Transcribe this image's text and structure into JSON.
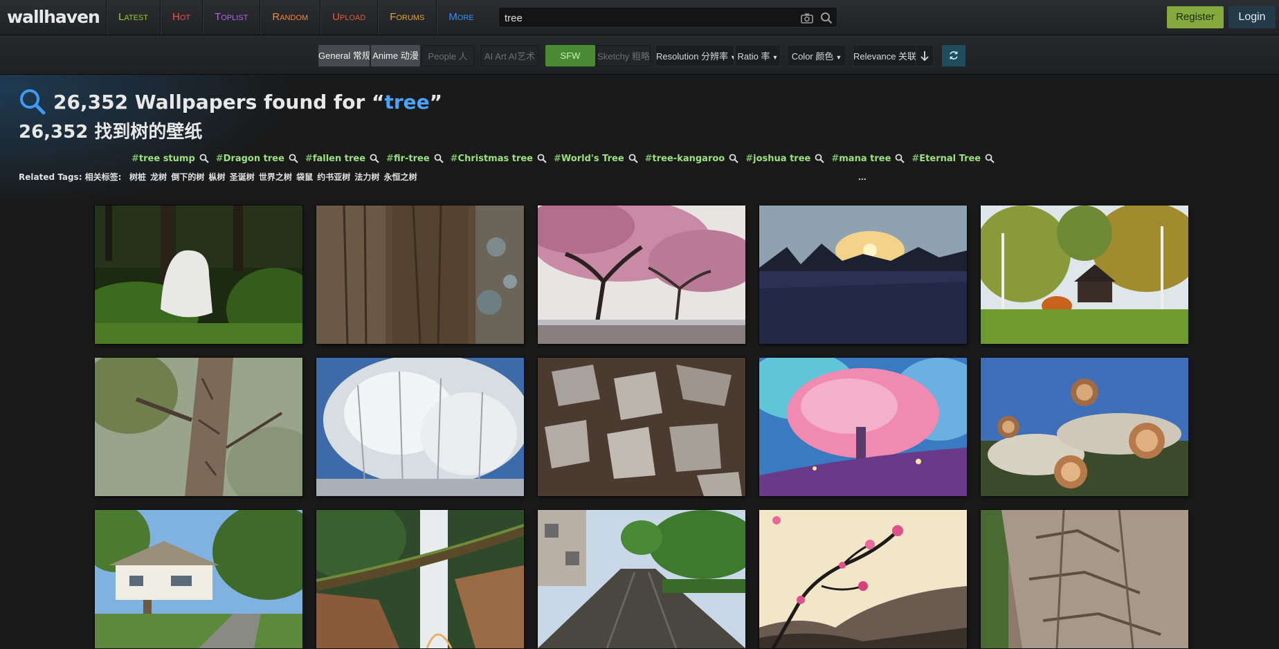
{
  "app": {
    "logo": "wallhaven"
  },
  "nav": [
    {
      "label": "Latest",
      "color": "#9acd32"
    },
    {
      "label": "Hot",
      "color": "#ff4a4a"
    },
    {
      "label": "Toplist",
      "color": "#b06ae0"
    },
    {
      "label": "Random",
      "color": "#f08a3a"
    },
    {
      "label": "Upload",
      "color": "#e85a3a"
    },
    {
      "label": "Forums",
      "color": "#e0a43a"
    },
    {
      "label": "More",
      "color": "#3a8ef0"
    }
  ],
  "search": {
    "value": "tree",
    "camera_icon": "camera-icon",
    "search_icon": "search-icon"
  },
  "auth": {
    "register": "Register",
    "login": "Login"
  },
  "filters": {
    "general": "General 常规",
    "anime": "Anime 动漫",
    "people": "People 人",
    "ai_art": "AI Art AI艺术",
    "sfw": "SFW",
    "sketchy": "Sketchy 粗略",
    "resolution": "Resolution 分辨率",
    "ratio": "Ratio 率",
    "color": "Color 颜色",
    "sort": "Relevance 关联",
    "order_icon": "sort-desc-icon",
    "refresh_icon": "refresh-icon"
  },
  "results": {
    "count": "26,352",
    "title_mid": " Wallpapers found for “",
    "query": "tree",
    "title_end": "”",
    "subtitle": "26,352 找到树的壁纸"
  },
  "tags": [
    "tree stump",
    "Dragon tree",
    "fallen tree",
    "fir-tree",
    "Christmas tree",
    "World's Tree",
    "tree-kangaroo",
    "joshua tree",
    "mana tree",
    "Eternal Tree"
  ],
  "related": {
    "label": "Related Tags: 相关标签:",
    "zh": "树桩 龙树 倒下的树 枞树 圣诞树 世界之树 袋鼠 约书亚树 法力树 永恒之树",
    "more": "..."
  },
  "thumbnails": [
    "tree stump in forest",
    "tree bark texture",
    "pink blossom trees by lake",
    "sunset over snowy field",
    "house among birch trees",
    "tree trunk close-up",
    "white weeping willow",
    "peeling bark texture",
    "glowing fantasy tree",
    "stacked cut logs",
    "treehouse cabins",
    "waterfall with fallen log",
    "wet road with trees",
    "cherry blossom branch painting",
    "bark close-up"
  ]
}
